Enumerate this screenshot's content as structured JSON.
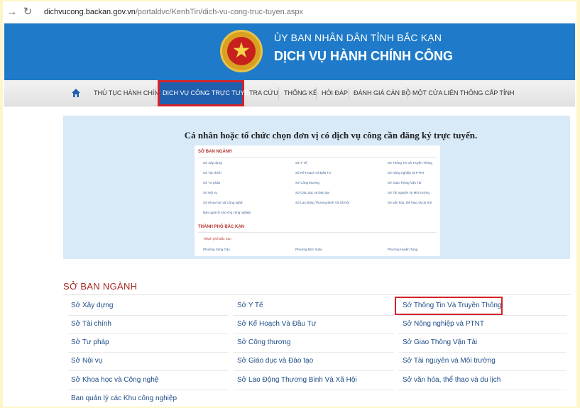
{
  "browser": {
    "url_host": "dichvucong.backan.gov.vn",
    "url_path": "/portaldvc/KenhTin/dich-vu-cong-truc-tuyen.aspx"
  },
  "header": {
    "subtitle": "ỦY BAN NHÂN DÂN TỈNH BẮC KẠN",
    "title": "DỊCH VỤ HÀNH CHÍNH CÔNG"
  },
  "menu": {
    "items": [
      "THỦ TỤC HÀNH CHÍNH",
      "DỊCH VỤ CÔNG TRỰC TUYẾN",
      "TRA CỨU",
      "THỐNG KÊ",
      "HỎI ĐÁP",
      "ĐÁNH GIÁ CÁN BỘ",
      "MỘT CỬA LIÊN THÔNG CẤP TỈNH"
    ]
  },
  "panel": {
    "title": "Cá nhân hoặc tổ chức chọn đơn vị có dịch vụ công cần đăng ký trực tuyến.",
    "mini": {
      "section1": "SỞ BAN NGÀNH",
      "items1": [
        "Sở Xây dựng",
        "Sở Y Tế",
        "Sở Thông Tin Và Truyền Thông",
        "Sở Tài chính",
        "Sở Kế Hoạch Và Đầu Tư",
        "Sở Nông nghiệp và PTNT",
        "Sở Tư pháp",
        "Sở Công thương",
        "Sở Giao Thông Vận Tải",
        "Sở Nội vụ",
        "Sở Giáo dục và Đào tạo",
        "Sở Tài nguyên và Môi trường",
        "Sở Khoa học và Công nghệ",
        "Sở Lao Động Thương Binh Và Xã Hội",
        "Sở văn hóa, thể thao và du lịch",
        "Ban quản lý các Khu công nghiệp"
      ],
      "section2": "THÀNH PHỐ BẮC KẠN",
      "city": "Thành phố Bắc Kạn",
      "items2": [
        "Phường Sông Cầu",
        "Phường Đức Xuân",
        "Phường Huyền Tụng"
      ]
    }
  },
  "section": {
    "title": "SỞ BAN NGÀNH",
    "rows": [
      [
        "Sở Xây dựng",
        "Sở Y Tế",
        "Sở Thông Tin Và Truyền Thông"
      ],
      [
        "Sở Tài chính",
        "Sở Kế Hoạch Và Đầu Tư",
        "Sở Nông nghiệp và PTNT"
      ],
      [
        "Sở Tư pháp",
        "Sở Công thương",
        "Sở Giao Thông Vận Tải"
      ],
      [
        "Sở Nội vụ",
        "Sở Giáo dục và Đào tạo",
        "Sở Tài nguyên và Môi trường"
      ],
      [
        "Sở Khoa học và Công nghệ",
        "Sở Lao Động Thương Binh Và Xã Hội",
        "Sở văn hóa, thể thao và du lịch"
      ],
      [
        "Ban quản lý các Khu công nghiệp"
      ]
    ]
  },
  "colors": {
    "banner": "#1f7bc9",
    "highlight": "#d4232a",
    "section_title": "#a52a22",
    "link": "#1e4d86"
  },
  "icons": {
    "back": "arrow-left-icon",
    "reload": "reload-icon",
    "home": "home-icon",
    "emblem": "national-emblem-icon"
  }
}
